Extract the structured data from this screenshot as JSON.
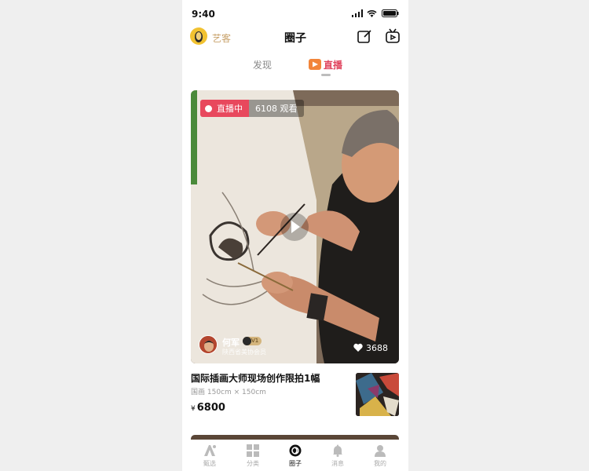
{
  "status_bar": {
    "time": "9:40"
  },
  "header": {
    "brand": "艺客",
    "title": "圈子"
  },
  "tabs": [
    {
      "label": "发现"
    },
    {
      "label": "直播"
    }
  ],
  "live_card": {
    "badge": "直播中",
    "viewers": "6108 观看",
    "author": {
      "name": "何军",
      "level": "V1",
      "subtitle": "陕西省美协会员"
    },
    "likes": "3688"
  },
  "listing": {
    "title": "国际插画大师现场创作限拍1幅",
    "meta": "国画   150cm × 150cm",
    "currency": "¥",
    "price": "6800"
  },
  "bottom_nav": [
    {
      "label": "甄选",
      "icon": "a-logo-icon"
    },
    {
      "label": "分类",
      "icon": "grid-icon"
    },
    {
      "label": "圈子",
      "icon": "circle-icon"
    },
    {
      "label": "消息",
      "icon": "bell-icon"
    },
    {
      "label": "我的",
      "icon": "person-icon"
    }
  ],
  "colors": {
    "accent": "#e8485d",
    "brand": "#c8a16a"
  }
}
